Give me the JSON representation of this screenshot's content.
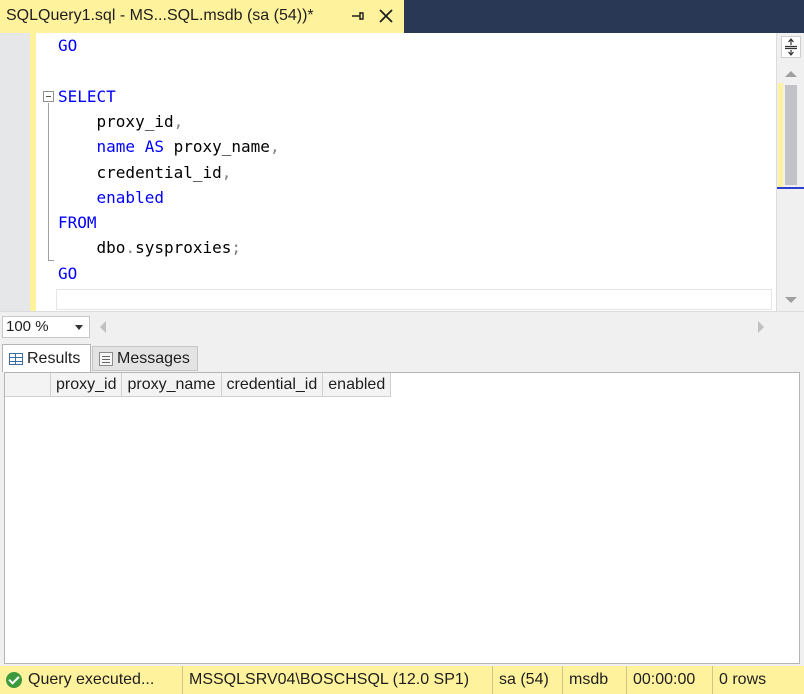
{
  "tab": {
    "title": "SQLQuery1.sql - MS...SQL.msdb (sa (54))*"
  },
  "editor": {
    "lines": [
      {
        "parts": [
          {
            "t": "GO",
            "c": "kw"
          }
        ]
      },
      {
        "parts": []
      },
      {
        "parts": [
          {
            "t": "SELECT",
            "c": "kw"
          }
        ]
      },
      {
        "parts": [
          {
            "t": "    proxy_id",
            "c": ""
          },
          {
            "t": ",",
            "c": "gray"
          }
        ]
      },
      {
        "parts": [
          {
            "t": "    ",
            "c": ""
          },
          {
            "t": "name",
            "c": "kw"
          },
          {
            "t": " ",
            "c": ""
          },
          {
            "t": "AS",
            "c": "kw"
          },
          {
            "t": " proxy_name",
            "c": ""
          },
          {
            "t": ",",
            "c": "gray"
          }
        ]
      },
      {
        "parts": [
          {
            "t": "    credential_id",
            "c": ""
          },
          {
            "t": ",",
            "c": "gray"
          }
        ]
      },
      {
        "parts": [
          {
            "t": "    ",
            "c": ""
          },
          {
            "t": "enabled",
            "c": "kw"
          }
        ]
      },
      {
        "parts": [
          {
            "t": "FROM",
            "c": "kw"
          }
        ]
      },
      {
        "parts": [
          {
            "t": "    dbo",
            "c": ""
          },
          {
            "t": ".",
            "c": "gray"
          },
          {
            "t": "sysproxies",
            "c": ""
          },
          {
            "t": ";",
            "c": "gray"
          }
        ]
      },
      {
        "parts": [
          {
            "t": "GO",
            "c": "kw"
          }
        ]
      }
    ]
  },
  "zoom": {
    "value": "100 %"
  },
  "results": {
    "tabs": [
      {
        "label": "Results"
      },
      {
        "label": "Messages"
      }
    ],
    "columns": [
      "proxy_id",
      "proxy_name",
      "credential_id",
      "enabled"
    ]
  },
  "status": {
    "message": "Query  executed...",
    "server": "MSSQLSRV04\\BOSCHSQL (12.0 SP1)",
    "user": "sa (54)",
    "database": "msdb",
    "time": "00:00:00",
    "rows": "0 rows"
  }
}
